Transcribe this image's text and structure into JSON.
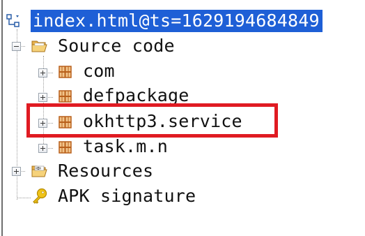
{
  "tree": {
    "root": {
      "label": "index.html@ts=1629194684849",
      "icon": "project-icon",
      "selected": true
    },
    "source_code": {
      "label": "Source code",
      "icon": "open-folder-icon",
      "expanded": true,
      "children": [
        {
          "label": "com",
          "icon": "package-icon",
          "expanded": false
        },
        {
          "label": "defpackage",
          "icon": "package-icon",
          "expanded": false
        },
        {
          "label": "okhttp3.service",
          "icon": "package-icon",
          "expanded": false,
          "highlighted": true
        },
        {
          "label": "task.m.n",
          "icon": "package-icon",
          "expanded": false
        }
      ]
    },
    "resources": {
      "label": "Resources",
      "icon": "resources-folder-icon",
      "expanded": false
    },
    "apk_signature": {
      "label": "APK signature",
      "icon": "key-icon"
    }
  },
  "colors": {
    "selection": "#1e5fd6",
    "highlight_border": "#e01b22",
    "package_icon": "#c9772a",
    "folder_icon": "#e8b04a",
    "key_icon": "#e8b800"
  }
}
